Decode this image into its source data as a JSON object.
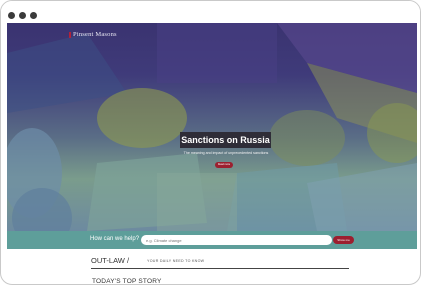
{
  "header": {
    "brand_name": "Pinsent Masons"
  },
  "hero": {
    "title": "Sanctions on Russia",
    "subtitle": "The meaning and impact of unprecedented sanctions",
    "button_label": "Read more"
  },
  "search": {
    "label": "How can we help?",
    "placeholder": "e.g. Climate change",
    "button_label": "Show me"
  },
  "outlaw": {
    "title": "OUT-LAW /",
    "tagline": "YOUR DAILY NEED TO KNOW"
  },
  "top_story": {
    "heading": "TODAY'S TOP STORY"
  },
  "colors": {
    "accent_red": "#9c1f2f",
    "search_bar_teal": "#5e9e9a",
    "title_box": "#2f2d38"
  }
}
